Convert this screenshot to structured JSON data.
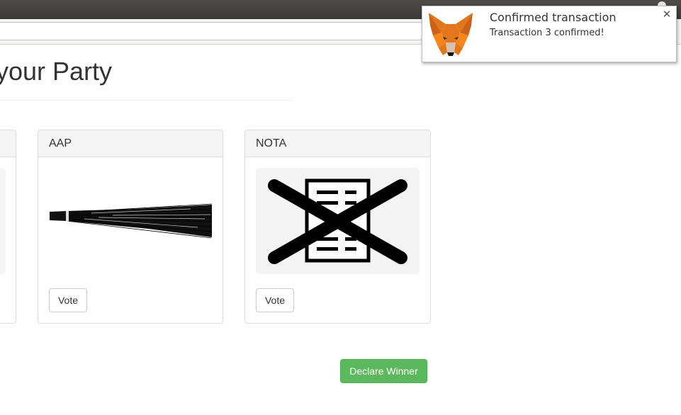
{
  "page": {
    "title": "your Party",
    "declare_label": "Declare Winner"
  },
  "candidates": [
    {
      "name": "",
      "vote_label": "",
      "symbol": ""
    },
    {
      "name": "AAP",
      "vote_label": "Vote",
      "symbol": "broom-icon"
    },
    {
      "name": "NOTA",
      "vote_label": "Vote",
      "symbol": "nota-ballot-icon"
    }
  ],
  "notification": {
    "title": "Confirmed transaction",
    "body": "Transaction 3 confirmed!",
    "close_glyph": "✕",
    "icon": "metamask-fox-icon"
  },
  "colors": {
    "success": "#5cb85c",
    "panel_heading": "#f5f5f5",
    "border": "#dddddd",
    "fox_orange": "#e2761b"
  }
}
